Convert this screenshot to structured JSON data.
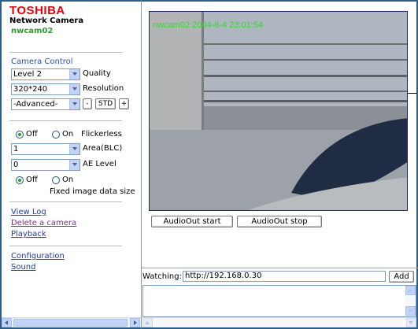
{
  "brand": {
    "logo": "TOSHIBA",
    "product": "Network Camera",
    "camera_name": "nwcam02"
  },
  "camera_control": {
    "title": "Camera Control",
    "quality": {
      "value": "Level 2",
      "label": "Quality"
    },
    "resolution": {
      "value": "320*240",
      "label": "Resolution"
    },
    "advanced": {
      "value": "-Advanced-",
      "minus": "-",
      "std": "STD",
      "plus": "+"
    }
  },
  "flickerless": {
    "off": "Off",
    "on": "On",
    "label": "Flickerless",
    "selected": "Off"
  },
  "area_blc": {
    "value": "1",
    "label": "Area(BLC)"
  },
  "ae_level": {
    "value": "0",
    "label": "AE Level"
  },
  "fixed_size": {
    "off": "Off",
    "on": "On",
    "label": "Fixed image data size",
    "selected": "Off"
  },
  "links": {
    "view_log": "View Log",
    "delete_camera": "Delete a camera",
    "playback": "Playback",
    "configuration": "Configuration",
    "sound": "Sound"
  },
  "video": {
    "overlay": "nwcam02  2004-8-4  23:01:54"
  },
  "audio": {
    "start": "AudioOut start",
    "stop": "AudioOut stop"
  },
  "watching": {
    "label": "Watching:",
    "url": "http://192.168.0.30",
    "add": "Add"
  },
  "colors": {
    "frame": "#2f5d86",
    "brand_red": "#e60012",
    "osd_green": "#2fdc2f",
    "link_blue": "#1f3aa8"
  }
}
